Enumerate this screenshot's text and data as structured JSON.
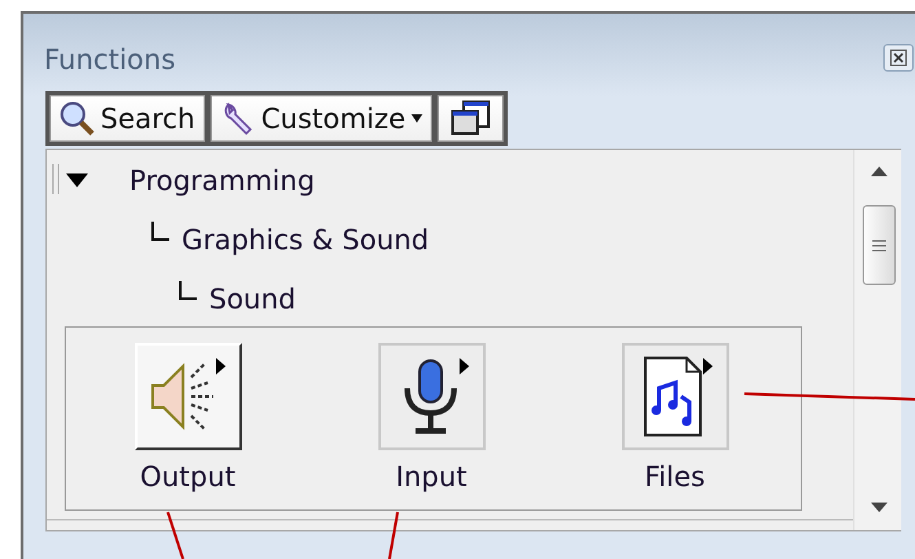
{
  "window": {
    "title": "Functions"
  },
  "toolbar": [
    {
      "kind": "search",
      "label": "Search"
    },
    {
      "kind": "customize",
      "label": "Customize",
      "dropdown": true
    },
    {
      "kind": "windows"
    }
  ],
  "tree": [
    {
      "label": "Programming",
      "expanded": true,
      "children": [
        {
          "label": "Graphics & Sound",
          "children": [
            {
              "label": "Sound"
            }
          ]
        }
      ]
    }
  ],
  "palette": [
    {
      "kind": "speaker",
      "label": "Output",
      "selected": true
    },
    {
      "kind": "microphone",
      "label": "Input",
      "selected": false
    },
    {
      "kind": "music-file",
      "label": "Files",
      "selected": false
    }
  ]
}
